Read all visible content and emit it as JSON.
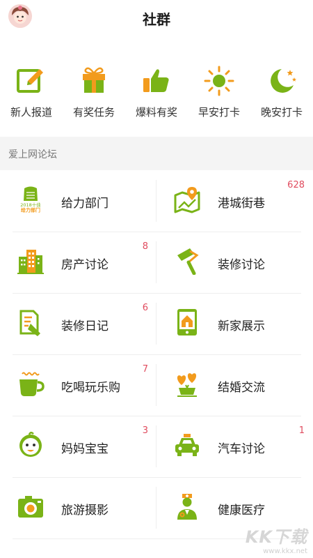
{
  "header": {
    "title": "社群"
  },
  "quick_actions": [
    {
      "label": "新人报道",
      "icon": "pencil-square-icon"
    },
    {
      "label": "有奖任务",
      "icon": "gift-box-icon"
    },
    {
      "label": "爆料有奖",
      "icon": "thumbs-up-icon"
    },
    {
      "label": "早安打卡",
      "icon": "sun-icon"
    },
    {
      "label": "晚安打卡",
      "icon": "moon-stars-icon"
    }
  ],
  "section": {
    "title": "爱上网论坛"
  },
  "forums": [
    {
      "label": "给力部门",
      "badge": "",
      "icon": "fist-badge-icon",
      "icon_text": [
        "2018十佳",
        "给力部门"
      ]
    },
    {
      "label": "港城街巷",
      "badge": "628",
      "icon": "map-pin-icon"
    },
    {
      "label": "房产讨论",
      "badge": "8",
      "icon": "buildings-icon"
    },
    {
      "label": "装修讨论",
      "badge": "",
      "icon": "paint-roller-icon"
    },
    {
      "label": "装修日记",
      "badge": "6",
      "icon": "document-edit-icon"
    },
    {
      "label": "新家展示",
      "badge": "",
      "icon": "phone-house-icon"
    },
    {
      "label": "吃喝玩乐购",
      "badge": "7",
      "icon": "coffee-cup-icon"
    },
    {
      "label": "结婚交流",
      "badge": "",
      "icon": "hearts-cup-icon"
    },
    {
      "label": "妈妈宝宝",
      "badge": "3",
      "icon": "baby-face-icon"
    },
    {
      "label": "汽车讨论",
      "badge": "1",
      "icon": "taxi-icon"
    },
    {
      "label": "旅游摄影",
      "badge": "",
      "icon": "camera-icon"
    },
    {
      "label": "健康医疗",
      "badge": "",
      "icon": "doctor-icon"
    }
  ],
  "watermark": {
    "logo": "KK下载",
    "url": "www.kkx.net"
  },
  "colors": {
    "green": "#7ab317",
    "orange": "#f29b1d",
    "badge": "#e04b5e"
  }
}
